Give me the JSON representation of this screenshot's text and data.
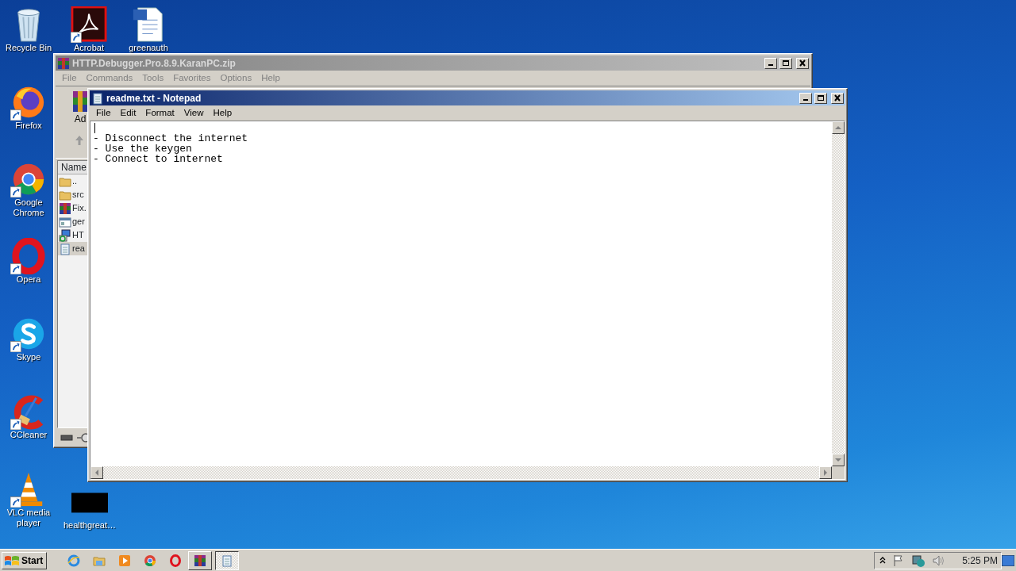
{
  "desktop": {
    "icons": [
      {
        "kind": "recycle",
        "label": "Recycle Bin"
      },
      {
        "kind": "acrobat",
        "label": "Acrobat"
      },
      {
        "kind": "word",
        "label": "greenauth"
      },
      {
        "kind": "firefox",
        "label": "Firefox"
      },
      {
        "kind": "chrome",
        "label": "Google Chrome"
      },
      {
        "kind": "opera",
        "label": "Opera"
      },
      {
        "kind": "skype",
        "label": "Skype"
      },
      {
        "kind": "ccleaner",
        "label": "CCleaner"
      },
      {
        "kind": "vlc",
        "label": "VLC media player"
      },
      {
        "kind": "thumbnail",
        "label": "healthgreat…"
      }
    ]
  },
  "archive_window": {
    "title": "HTTP.Debugger.Pro.8.9.KaranPC.zip",
    "active": false,
    "menu": [
      "File",
      "Commands",
      "Tools",
      "Favorites",
      "Options",
      "Help"
    ],
    "toolbar_label": "Ad",
    "column": "Name",
    "files": [
      {
        "kind": "folder",
        "name": "..",
        "selected": false
      },
      {
        "kind": "folder",
        "name": "src",
        "selected": false
      },
      {
        "kind": "archive",
        "name": "Fix.",
        "selected": false
      },
      {
        "kind": "program",
        "name": "ger",
        "selected": false
      },
      {
        "kind": "installer",
        "name": "HT",
        "selected": false
      },
      {
        "kind": "text",
        "name": "rea",
        "selected": true
      }
    ]
  },
  "notepad_window": {
    "title": "readme.txt - Notepad",
    "active": true,
    "menu": [
      "File",
      "Edit",
      "Format",
      "View",
      "Help"
    ],
    "lines": [
      "- Disconnect the internet",
      "- Use the keygen",
      "- Connect to internet"
    ]
  },
  "taskbar": {
    "start": "Start",
    "quick_launch": [
      {
        "kind": "ie"
      },
      {
        "kind": "explorer"
      },
      {
        "kind": "media"
      },
      {
        "kind": "chrome"
      },
      {
        "kind": "opera"
      }
    ],
    "tasks": [
      {
        "kind": "archive",
        "selected": false
      },
      {
        "kind": "notepad",
        "selected": true
      }
    ],
    "clock": "5:25 PM"
  }
}
